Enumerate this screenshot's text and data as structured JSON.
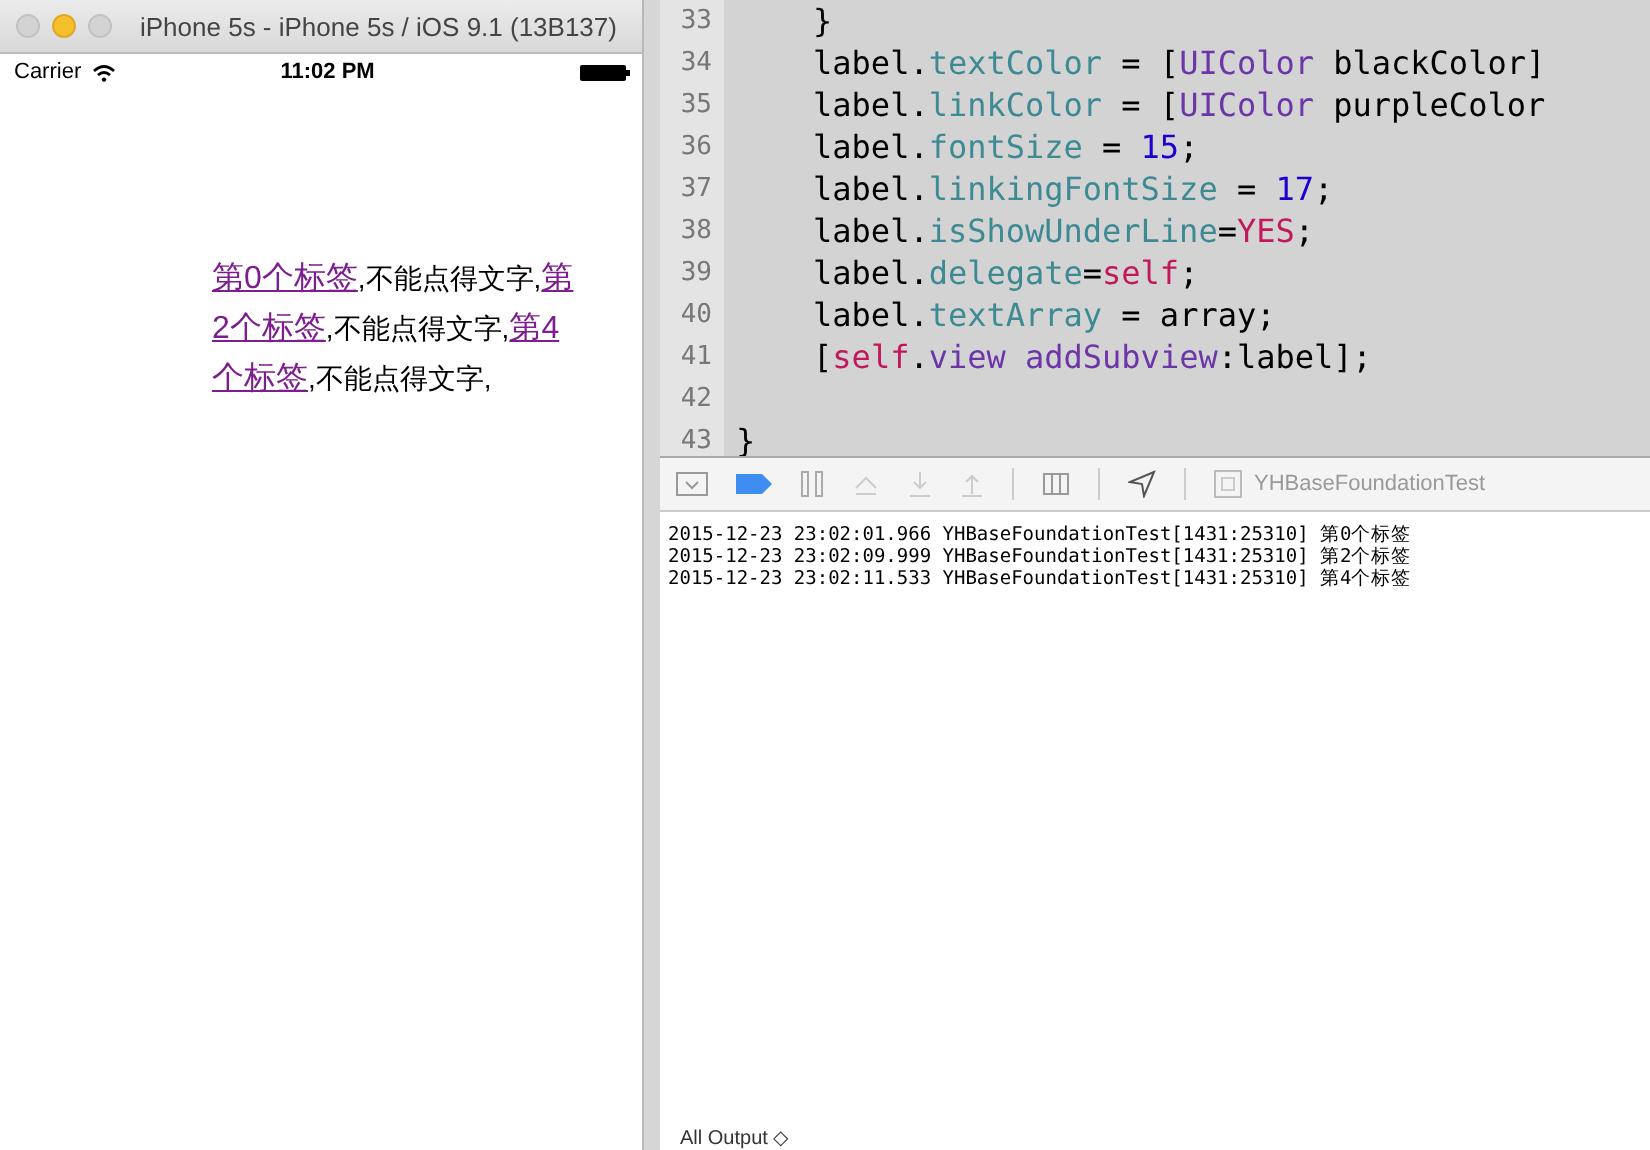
{
  "simulator": {
    "title": "iPhone 5s - iPhone 5s / iOS 9.1 (13B137)",
    "status_bar": {
      "carrier": "Carrier",
      "time": "11:02 PM"
    },
    "label": [
      {
        "kind": "link",
        "text": "第0个标签"
      },
      {
        "kind": "plain",
        "text": ",不能点得文字,"
      },
      {
        "kind": "link",
        "text": "第2个标签"
      },
      {
        "kind": "plain",
        "text": ",不能点得文字,"
      },
      {
        "kind": "link",
        "text": "第4个标签"
      },
      {
        "kind": "plain",
        "text": ",不能点得文字,"
      }
    ]
  },
  "editor": {
    "lines": [
      {
        "number": "33",
        "tokens": [
          {
            "kind": "plain",
            "text": "    }"
          }
        ]
      },
      {
        "number": "34",
        "tokens": [
          {
            "kind": "plain",
            "text": "    label."
          },
          {
            "kind": "property",
            "text": "textColor"
          },
          {
            "kind": "plain",
            "text": " = ["
          },
          {
            "kind": "class",
            "text": "UIColor"
          },
          {
            "kind": "plain",
            "text": " blackColor]"
          }
        ]
      },
      {
        "number": "35",
        "tokens": [
          {
            "kind": "plain",
            "text": "    label."
          },
          {
            "kind": "property",
            "text": "linkColor"
          },
          {
            "kind": "plain",
            "text": " = ["
          },
          {
            "kind": "class",
            "text": "UIColor"
          },
          {
            "kind": "plain",
            "text": " purpleColor"
          }
        ]
      },
      {
        "number": "36",
        "tokens": [
          {
            "kind": "plain",
            "text": "    label."
          },
          {
            "kind": "property",
            "text": "fontSize"
          },
          {
            "kind": "plain",
            "text": " = "
          },
          {
            "kind": "number",
            "text": "15"
          },
          {
            "kind": "plain",
            "text": ";"
          }
        ]
      },
      {
        "number": "37",
        "tokens": [
          {
            "kind": "plain",
            "text": "    label."
          },
          {
            "kind": "property",
            "text": "linkingFontSize"
          },
          {
            "kind": "plain",
            "text": " = "
          },
          {
            "kind": "number",
            "text": "17"
          },
          {
            "kind": "plain",
            "text": ";"
          }
        ]
      },
      {
        "number": "38",
        "tokens": [
          {
            "kind": "plain",
            "text": "    label."
          },
          {
            "kind": "property",
            "text": "isShowUnderLine"
          },
          {
            "kind": "plain",
            "text": "="
          },
          {
            "kind": "keyword",
            "text": "YES"
          },
          {
            "kind": "plain",
            "text": ";"
          }
        ]
      },
      {
        "number": "39",
        "tokens": [
          {
            "kind": "plain",
            "text": "    label."
          },
          {
            "kind": "property",
            "text": "delegate"
          },
          {
            "kind": "plain",
            "text": "="
          },
          {
            "kind": "keyword",
            "text": "self"
          },
          {
            "kind": "plain",
            "text": ";"
          }
        ]
      },
      {
        "number": "40",
        "tokens": [
          {
            "kind": "plain",
            "text": "    label."
          },
          {
            "kind": "property",
            "text": "textArray"
          },
          {
            "kind": "plain",
            "text": " = array;"
          }
        ]
      },
      {
        "number": "41",
        "tokens": [
          {
            "kind": "plain",
            "text": "    ["
          },
          {
            "kind": "keyword",
            "text": "self"
          },
          {
            "kind": "plain",
            "text": "."
          },
          {
            "kind": "class",
            "text": "view addSubview"
          },
          {
            "kind": "plain",
            "text": ":label];"
          }
        ]
      },
      {
        "number": "42"
      },
      {
        "number": "43",
        "tokens": [
          {
            "kind": "plain",
            "text": "}"
          }
        ]
      }
    ]
  },
  "debug_bar": {
    "target": "YHBaseFoundationTest"
  },
  "console": {
    "lines": [
      "2015-12-23 23:02:01.966 YHBaseFoundationTest[1431:25310] 第0个标签",
      "2015-12-23 23:02:09.999 YHBaseFoundationTest[1431:25310] 第2个标签",
      "2015-12-23 23:02:11.533 YHBaseFoundationTest[1431:25310] 第4个标签"
    ],
    "filter": "All Output ◇"
  }
}
